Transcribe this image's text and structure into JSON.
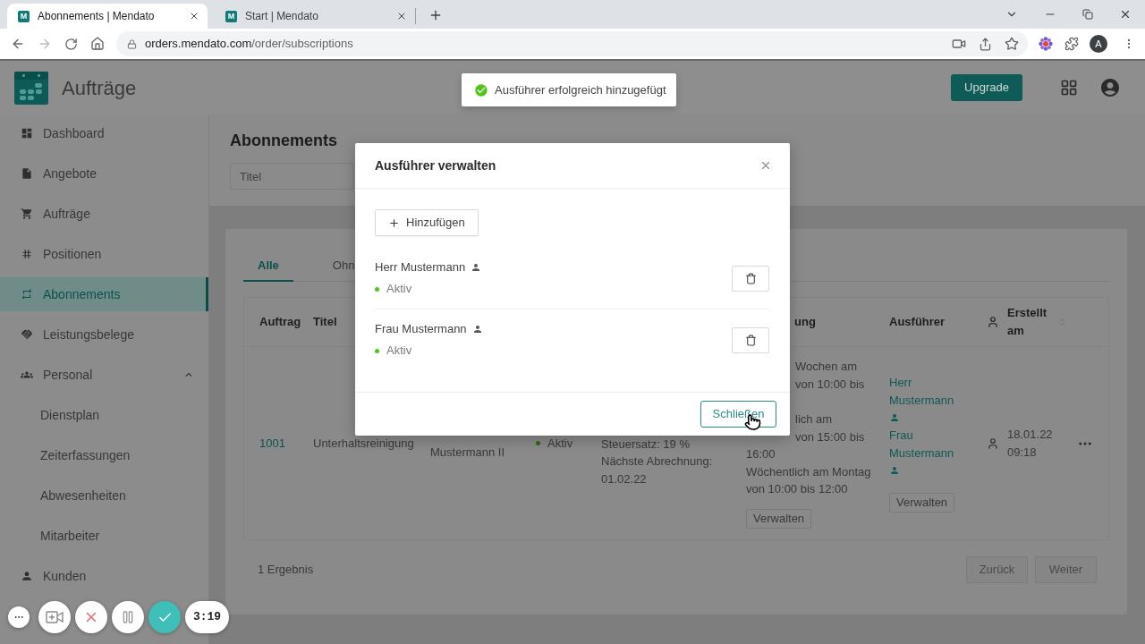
{
  "browser": {
    "tabs": [
      {
        "favicon": "M",
        "title": "Abonnements | Mendato",
        "selected": true
      },
      {
        "favicon": "M",
        "title": "Start | Mendato",
        "selected": false
      }
    ],
    "url": {
      "host": "orders.mendato.com",
      "path": "/order/subscriptions"
    },
    "profile_initial": "A"
  },
  "app_header": {
    "title": "Aufträge",
    "upgrade_button": "Upgrade"
  },
  "toast": {
    "message": "Ausführer erfolgreich hinzugefügt"
  },
  "sidebar": {
    "items": [
      {
        "label": "Dashboard",
        "selected": false
      },
      {
        "label": "Angebote",
        "selected": false
      },
      {
        "label": "Aufträge",
        "selected": false
      },
      {
        "label": "Positionen",
        "selected": false
      },
      {
        "label": "Abonnements",
        "selected": true
      },
      {
        "label": "Leistungsbelege",
        "selected": false
      },
      {
        "label": "Personal",
        "selected": false,
        "expanded": true,
        "children": [
          {
            "label": "Dienstplan",
            "selected": false
          },
          {
            "label": "Zeiterfassungen",
            "selected": false
          },
          {
            "label": "Abwesenheiten",
            "selected": false
          },
          {
            "label": "Mitarbeiter",
            "selected": false
          }
        ]
      },
      {
        "label": "Kunden",
        "selected": false
      }
    ]
  },
  "page": {
    "title": "Abonnements",
    "search": {
      "placeholder": "Titel"
    },
    "tabs": [
      {
        "label": "Alle",
        "selected": true
      },
      {
        "label": "Ohn",
        "selected": false
      }
    ],
    "table": {
      "columns": [
        "Auftrag",
        "Titel",
        "ung",
        "Ausführer",
        "Erstellt am"
      ],
      "rows": [
        {
          "order": "1001",
          "title": "Unterhaltsreinigung",
          "column_3": "Mustermann II",
          "column_4": {
            "status": "Aktiv",
            "active": true
          },
          "column_5": [
            "Steuersatz: 19 %",
            "Nächste Abrechnung:",
            "01.02.22"
          ],
          "column_6": {
            "covered_lines": [
              [
                "Wochen am",
                "von 10:00 bis"
              ],
              [
                "lich am",
                "von 15:00 bis"
              ]
            ],
            "lines": [
              "16:00",
              "Wöchentlich am Montag",
              "von 10:00 bis 12:00"
            ],
            "button": "Verwalten"
          },
          "executors": [
            {
              "name": "Herr Mustermann"
            },
            {
              "name": "Frau Mustermann"
            }
          ],
          "executors_button": "Verwalten",
          "created": "18.01.22 09:18"
        }
      ]
    },
    "result_count": "1 Ergebnis",
    "pagination": [
      {
        "label": "Zurück",
        "disabled": true
      },
      {
        "label": "Weiter",
        "disabled": true
      }
    ]
  },
  "modal": {
    "title": "Ausführer verwalten",
    "add_button": "Hinzufügen",
    "executors": [
      {
        "name": "Herr Mustermann",
        "status": "Aktiv",
        "active": true
      },
      {
        "name": "Frau Mustermann",
        "status": "Aktiv",
        "active": true
      }
    ],
    "close_button": "Schließen"
  },
  "recorder": {
    "timer": "3:19"
  }
}
